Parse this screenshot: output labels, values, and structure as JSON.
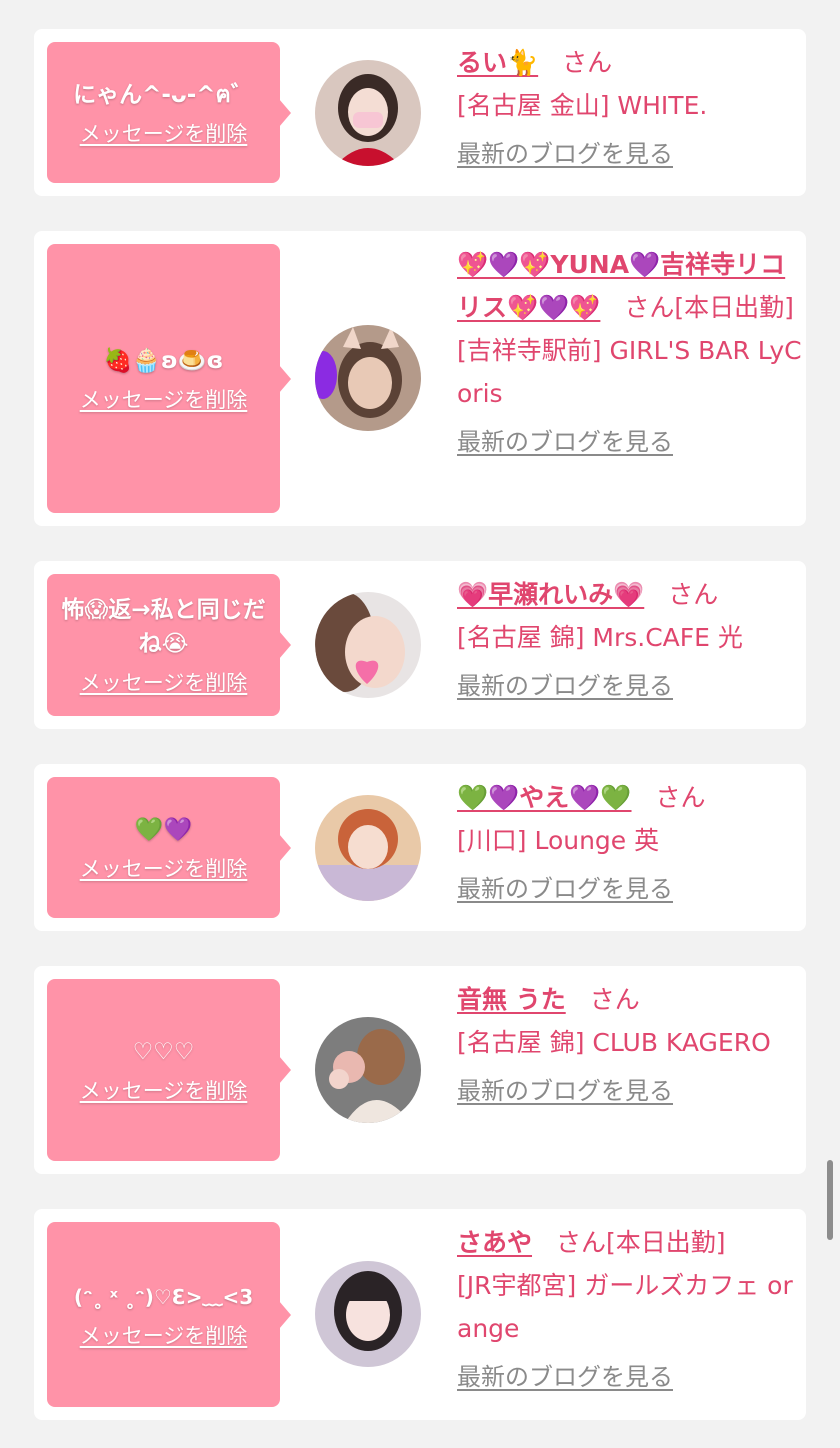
{
  "delete_label": "メッセージを削除",
  "blog_label": "最新のブログを見る",
  "san": "さん",
  "cards": [
    {
      "message": "にゃん^-ᴗ-^ฅ゛",
      "name": "るい🐈",
      "tag": "",
      "shop": "[名古屋 金山] WHITE."
    },
    {
      "message": "🍓🧁ʚ🍮ɞ",
      "name": "💖💜💖YUNA💜吉祥寺リコリス💖💜💖",
      "tag": "[本日出勤]",
      "shop": "[吉祥寺駅前] GIRL'S BAR LyCoris"
    },
    {
      "message": "怖😱返→私と同じだね😭",
      "name": "💗早瀬れいみ💗",
      "tag": "",
      "shop": "[名古屋 錦] Mrs.CAFE 光"
    },
    {
      "message": "💚💜",
      "name": "💚💜やえ💜💚",
      "tag": "",
      "shop": "[川口] Lounge 英"
    },
    {
      "message": "♡♡♡",
      "name": "音無 うた",
      "tag": "",
      "shop": "[名古屋 錦] CLUB KAGERO"
    },
    {
      "message": "(ᵔ˳ ˣ ˳ᵔ)♡Ɛ>﹏<3",
      "name": "さあや",
      "tag": "[本日出勤]",
      "shop": "[JR宇都宮] ガールズカフェ orange"
    }
  ],
  "avatar_icons": [
    "avatar-photo-icon",
    "avatar-photo-icon",
    "avatar-photo-icon",
    "avatar-photo-icon",
    "avatar-photo-icon",
    "avatar-photo-icon"
  ],
  "colors": {
    "bubble": "#ff93a8",
    "accent_text": "#e0466e",
    "blog_link": "#8a8a8a",
    "page_background": "#f2f2f2",
    "card_background": "#ffffff"
  }
}
